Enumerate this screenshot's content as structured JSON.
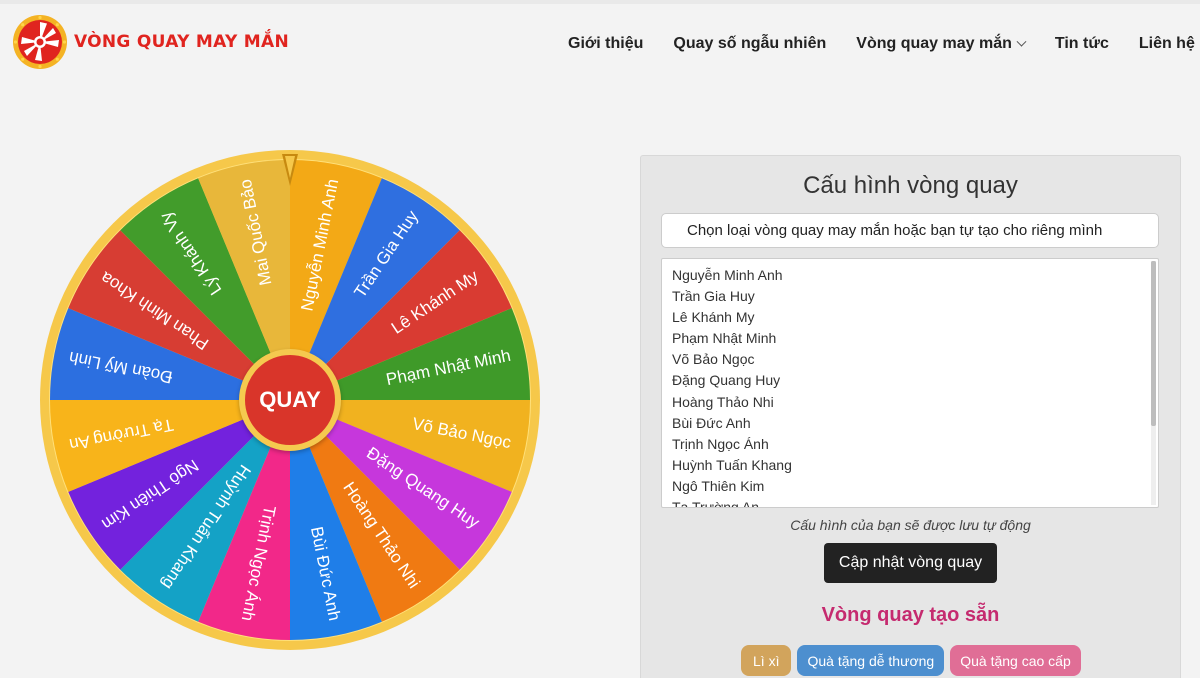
{
  "header": {
    "logo_text": "VÒNG QUAY MAY MẮN",
    "nav": [
      {
        "label": "Giới thiệu"
      },
      {
        "label": "Quay số ngẫu nhiên"
      },
      {
        "label": "Vòng quay may mắn"
      },
      {
        "label": "Tin tức"
      },
      {
        "label": "Liên hệ"
      }
    ]
  },
  "wheel": {
    "spin_label": "QUAY",
    "segments": [
      {
        "name": "Nguyễn Minh Anh",
        "color": "#f3a916"
      },
      {
        "name": "Trần Gia Huy",
        "color": "#2f6fe0"
      },
      {
        "name": "Lê Khánh My",
        "color": "#d93b32"
      },
      {
        "name": "Phạm Nhật Minh",
        "color": "#3f9a29"
      },
      {
        "name": "Võ Bảo Ngọc",
        "color": "#f1b21f"
      },
      {
        "name": "Đặng Quang Huy",
        "color": "#c637dc"
      },
      {
        "name": "Hoàng Thảo Nhi",
        "color": "#f07a12"
      },
      {
        "name": "Bùi Đức Anh",
        "color": "#1f7ee8"
      },
      {
        "name": "Trịnh Ngọc Ánh",
        "color": "#f22889"
      },
      {
        "name": "Huỳnh Tuấn Khang",
        "color": "#14a2c6"
      },
      {
        "name": "Ngô Thiên Kim",
        "color": "#7322dd"
      },
      {
        "name": "Tạ Trường An",
        "color": "#f8b41a"
      },
      {
        "name": "Đoàn Mỹ Linh",
        "color": "#2c6fe0"
      },
      {
        "name": "Phan Minh Khoa",
        "color": "#d73d33"
      },
      {
        "name": "Lý Khánh Vy",
        "color": "#429c2b"
      },
      {
        "name": "Mai Quốc Bảo",
        "color": "#e8b73a"
      }
    ]
  },
  "panel": {
    "title": "Cấu hình vòng quay",
    "select_value": "Chọn loại vòng quay may mắn hoặc bạn tự tạo cho riêng mình",
    "names": [
      "Nguyễn Minh Anh",
      "Trần Gia Huy",
      "Lê Khánh My",
      "Phạm Nhật Minh",
      "Võ Bảo Ngọc",
      "Đặng Quang Huy",
      "Hoàng Thảo Nhi",
      "Bùi Đức Anh",
      "Trịnh Ngọc Ánh",
      "Huỳnh Tuấn Khang",
      "Ngô Thiên Kim",
      "Tạ Trường An"
    ],
    "note": "Cấu hình của bạn sẽ được lưu tự động",
    "update_button": "Cập nhật vòng quay",
    "preset_title": "Vòng quay tạo sẵn",
    "presets": [
      {
        "label": "Lì xì",
        "color": "#d2a45c"
      },
      {
        "label": "Quà tặng dễ thương",
        "color": "#4d8fcf"
      },
      {
        "label": "Quà tặng cao cấp",
        "color": "#e06e96"
      }
    ]
  }
}
